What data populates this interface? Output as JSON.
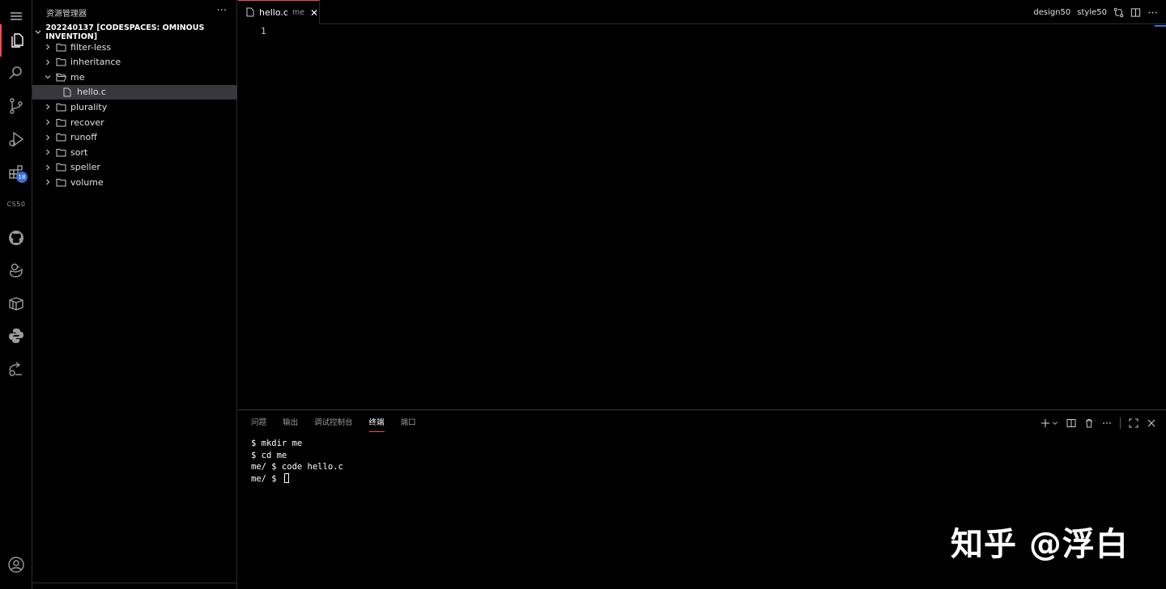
{
  "activity_bar": {
    "icons": [
      "menu-icon",
      "explorer-icon",
      "search-icon",
      "source-control-icon",
      "run-debug-icon",
      "extensions-icon",
      "cs50-text",
      "github-icon",
      "duck-icon",
      "box-icon",
      "python-icon",
      "remote-icon",
      "account-icon"
    ],
    "extensions_badge": "18",
    "cs50_label": "CS50"
  },
  "sidebar": {
    "title": "资源管理器",
    "more": "···",
    "workspace": "202240137 [CODESPACES: OMINOUS INVENTION]",
    "items": [
      {
        "label": "filter-less",
        "type": "folder",
        "expanded": false
      },
      {
        "label": "inheritance",
        "type": "folder",
        "expanded": false
      },
      {
        "label": "me",
        "type": "folder",
        "expanded": true
      },
      {
        "label": "hello.c",
        "type": "file",
        "selected": true
      },
      {
        "label": "plurality",
        "type": "folder",
        "expanded": false
      },
      {
        "label": "recover",
        "type": "folder",
        "expanded": false
      },
      {
        "label": "runoff",
        "type": "folder",
        "expanded": false
      },
      {
        "label": "sort",
        "type": "folder",
        "expanded": false
      },
      {
        "label": "speller",
        "type": "folder",
        "expanded": false
      },
      {
        "label": "volume",
        "type": "folder",
        "expanded": false
      }
    ]
  },
  "editor": {
    "tab": {
      "name": "hello.c",
      "desc": "me",
      "close": "✕"
    },
    "actions": {
      "design": "design50",
      "style": "style50"
    },
    "line_number": "1"
  },
  "panel": {
    "tabs": [
      "问题",
      "输出",
      "调试控制台",
      "终端",
      "端口"
    ],
    "active_tab": "终端",
    "terminal_lines": [
      "$ mkdir me",
      "$ cd me",
      "me/ $ code hello.c",
      "me/ $ "
    ]
  },
  "watermark": "知乎 @浮白",
  "colors": {
    "accent": "#f14c4c",
    "badge": "#3b6fd8",
    "selection": "#37373d"
  }
}
